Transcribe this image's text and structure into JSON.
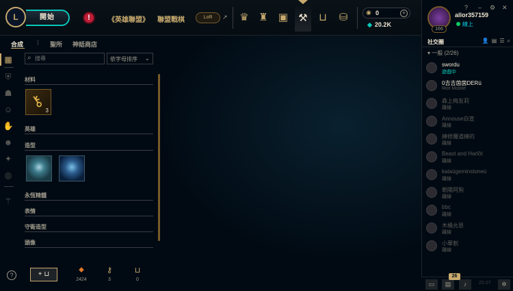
{
  "topnav": {
    "logo": "L",
    "play_label": "開始",
    "alert": "!",
    "links": [
      "《英雄聯盟》",
      "聯盟戰棋"
    ],
    "lor_label": "LoR",
    "lor_arrow": "↗",
    "icons": [
      "profile-icon",
      "trophy-icon",
      "collection-icon",
      "loot-icon",
      "store-icon",
      "coins-icon"
    ]
  },
  "currency": {
    "rp": "0",
    "plus": "+",
    "be": "20.2K"
  },
  "profile": {
    "username": "allor357159",
    "status": "線上",
    "level": "166",
    "controls": [
      "?",
      "–",
      "⚙",
      "✕"
    ]
  },
  "subtabs": [
    "合成",
    "聖所",
    "神話商店"
  ],
  "search": {
    "placeholder": "搜尋",
    "sort_label": "依字母排序"
  },
  "sections": {
    "materials": "材料",
    "materials_count": "3",
    "champions": "英雄",
    "skins": "造型",
    "eternals": "永恆精髓",
    "emotes": "表情",
    "ward_skins": "守衛造型",
    "icons": "頭像"
  },
  "bottom": {
    "help": "?",
    "add": "+",
    "stats": [
      {
        "icon": "orange-essence-icon",
        "value": "2424"
      },
      {
        "icon": "key-fragment-icon",
        "value": "3"
      },
      {
        "icon": "chest-icon",
        "value": "0"
      }
    ]
  },
  "social": {
    "header": "社交圈",
    "group": "一般 (2/26)",
    "friends": [
      {
        "name": "swordu",
        "status": "遊戲中",
        "state": "online"
      },
      {
        "name": "0吉吉茵茵DERü",
        "status": "Riot Mobile",
        "state": "mobile"
      },
      {
        "name": "森上梅友莉",
        "status": "離線",
        "state": "offline"
      },
      {
        "name": "Annouse白宣",
        "status": "離線",
        "state": "offline"
      },
      {
        "name": "練修羅道練的",
        "status": "離線",
        "state": "offline"
      },
      {
        "name": "Beast and Harlôt",
        "status": "離線",
        "state": "offline"
      },
      {
        "name": "kataügeminstoneü",
        "status": "離線",
        "state": "offline"
      },
      {
        "name": "朝陽阿狗",
        "status": "離線",
        "state": "offline"
      },
      {
        "name": "bbc",
        "status": "離線",
        "state": "offline"
      },
      {
        "name": "木桶允恩",
        "status": "離線",
        "state": "offline"
      },
      {
        "name": "小華割",
        "status": "離線",
        "state": "offline"
      }
    ],
    "notif_count": "26",
    "version": "25.07"
  },
  "colors": {
    "gold": "#c8aa6e",
    "teal": "#0ac8b9",
    "background": "#010a13"
  }
}
